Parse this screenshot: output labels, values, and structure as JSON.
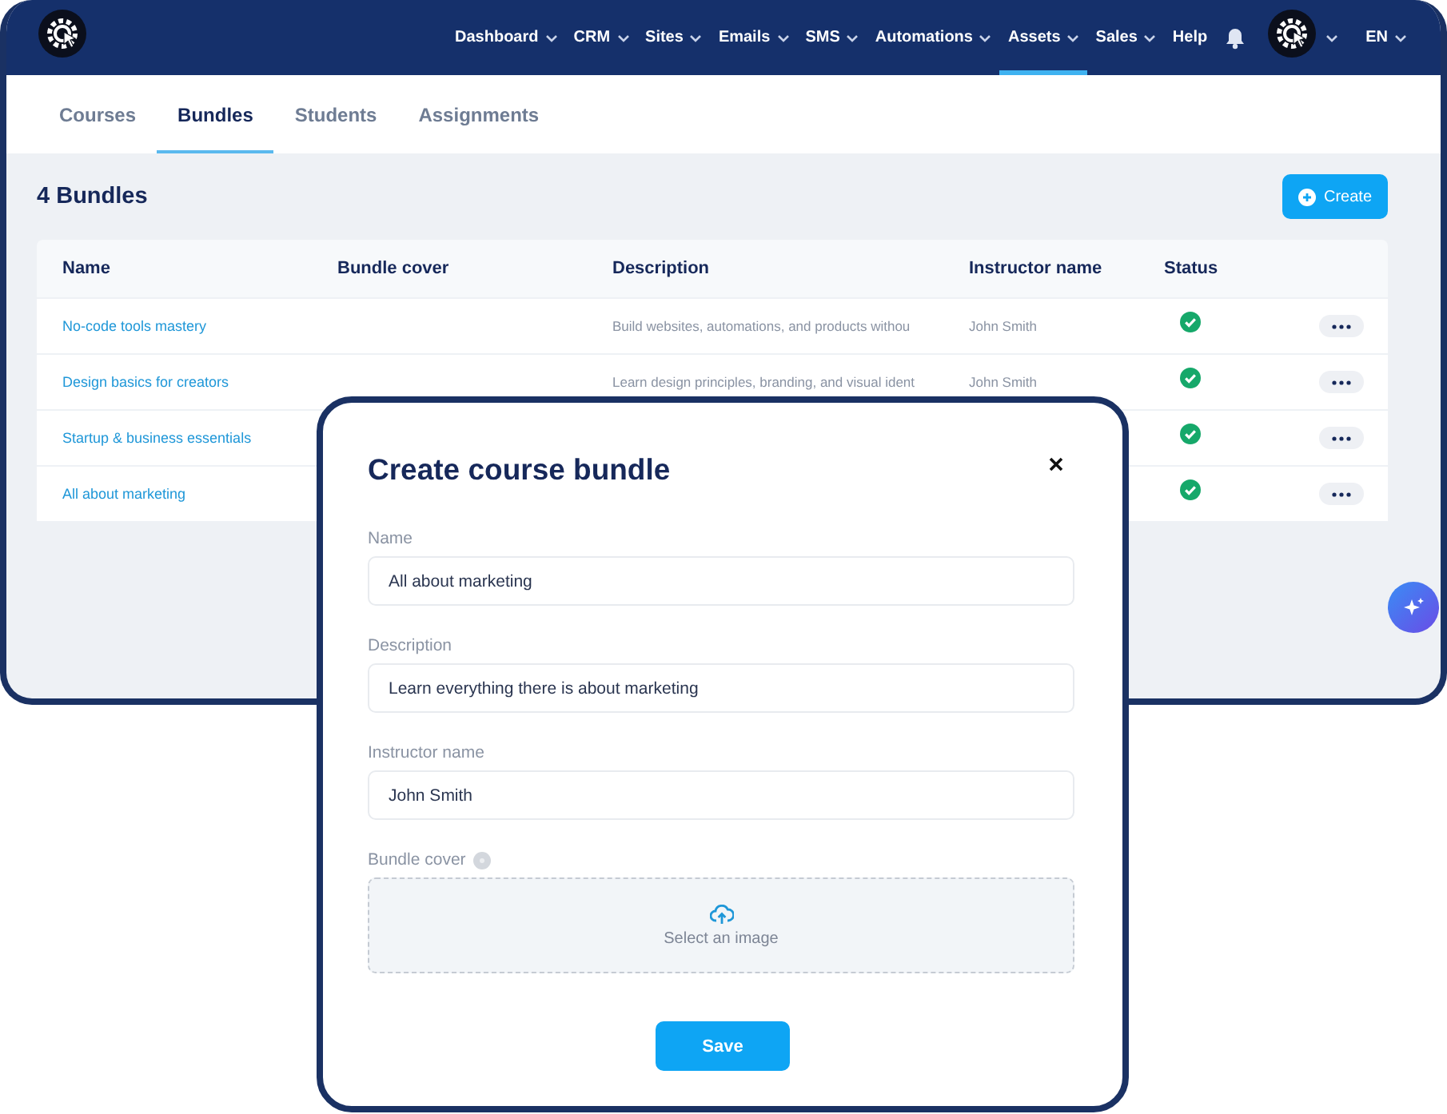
{
  "nav": {
    "items": [
      {
        "label": "Dashboard",
        "has_menu": true,
        "selected": false
      },
      {
        "label": "CRM",
        "has_menu": true,
        "selected": false
      },
      {
        "label": "Sites",
        "has_menu": true,
        "selected": false
      },
      {
        "label": "Emails",
        "has_menu": true,
        "selected": false
      },
      {
        "label": "SMS",
        "has_menu": true,
        "selected": false
      },
      {
        "label": "Automations",
        "has_menu": true,
        "selected": false
      },
      {
        "label": "Assets",
        "has_menu": true,
        "selected": true
      },
      {
        "label": "Sales",
        "has_menu": true,
        "selected": false
      },
      {
        "label": "Help",
        "has_menu": false,
        "selected": false
      }
    ],
    "language": "EN"
  },
  "tabs": [
    {
      "label": "Courses",
      "selected": false
    },
    {
      "label": "Bundles",
      "selected": true
    },
    {
      "label": "Students",
      "selected": false
    },
    {
      "label": "Assignments",
      "selected": false
    }
  ],
  "heading": "4 Bundles",
  "create_button": "Create",
  "table": {
    "columns": [
      "Name",
      "Bundle cover",
      "Description",
      "Instructor name",
      "Status"
    ],
    "rows": [
      {
        "name": "No-code tools mastery",
        "description": "Build websites, automations, and products withou",
        "instructor": "John Smith",
        "active": true
      },
      {
        "name": "Design basics for creators",
        "description": "Learn design principles, branding, and visual ident",
        "instructor": "John Smith",
        "active": true
      },
      {
        "name": "Startup & business essentials",
        "active": true
      },
      {
        "name": "All about marketing",
        "active": true
      }
    ]
  },
  "modal": {
    "title": "Create course bundle",
    "fields": [
      {
        "label": "Name",
        "value": "All about marketing"
      },
      {
        "label": "Description",
        "value": "Learn everything there is about marketing"
      },
      {
        "label": "Instructor name",
        "value": "John Smith"
      }
    ],
    "cover_label": "Bundle cover",
    "upload_text": "Select an image",
    "save_button": "Save"
  }
}
